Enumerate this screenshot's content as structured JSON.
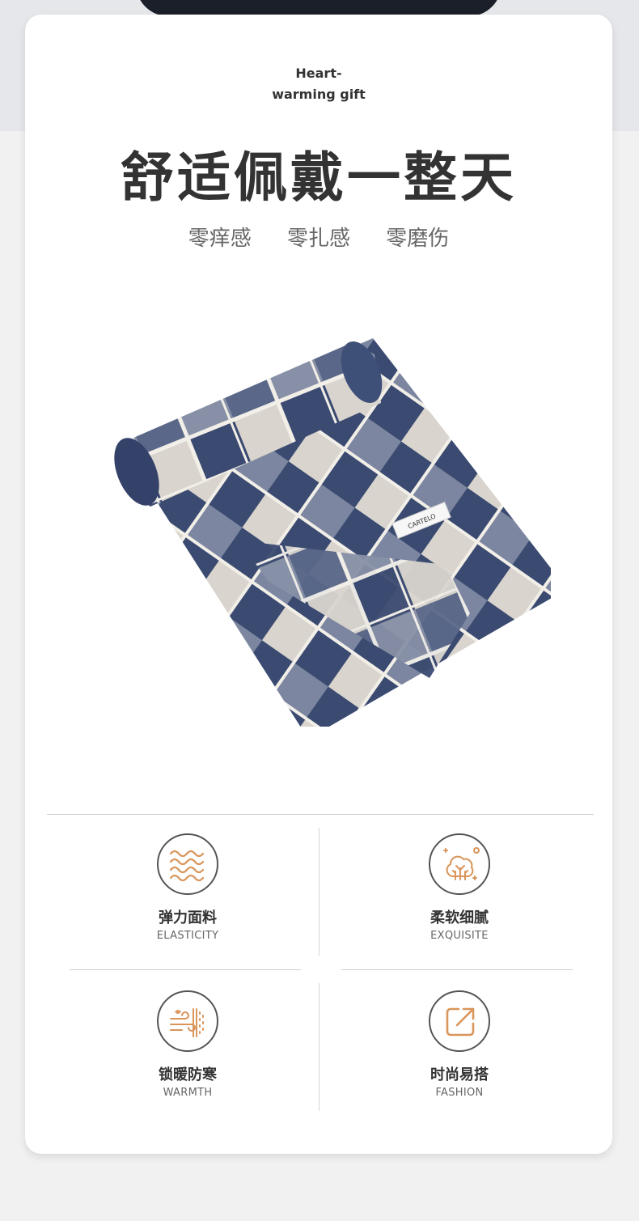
{
  "eyebrow": {
    "line1": "Heart-",
    "line2": "warming gift"
  },
  "headline": "舒适佩戴一整天",
  "subtitle": [
    "零痒感",
    "零扎感",
    "零磨伤"
  ],
  "product": {
    "label_text": "CARTELO"
  },
  "features": [
    {
      "zh": "弹力面料",
      "en": "ELASTICITY",
      "icon": "wave-icon"
    },
    {
      "zh": "柔软细腻",
      "en": "EXQUISITE",
      "icon": "soft-tree-icon"
    },
    {
      "zh": "锁暖防寒",
      "en": "WARMTH",
      "icon": "wind-warmth-icon"
    },
    {
      "zh": "时尚易搭",
      "en": "FASHION",
      "icon": "arrow-box-icon"
    }
  ],
  "colors": {
    "accent": "#d9955a",
    "navy": "#35466b",
    "cream": "#dcd7d0"
  }
}
